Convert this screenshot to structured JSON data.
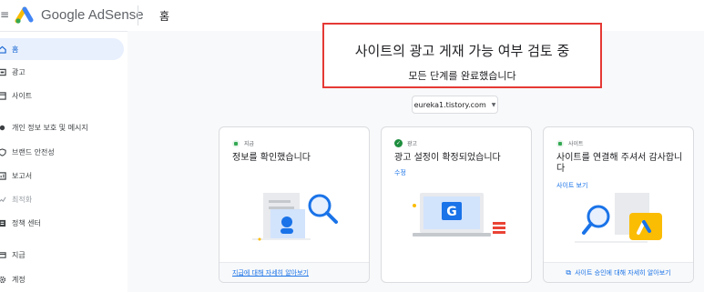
{
  "header": {
    "brand": "Google AdSense",
    "breadcrumb": "홈"
  },
  "sidebar": {
    "items": [
      {
        "label": "홈",
        "icon": "home-icon"
      },
      {
        "label": "광고",
        "icon": "ads-icon"
      },
      {
        "label": "사이트",
        "icon": "sites-icon"
      },
      {
        "label": "개인 정보 보호 및 메시지",
        "icon": "privacy-icon"
      },
      {
        "label": "브랜드 안전성",
        "icon": "shield-icon"
      },
      {
        "label": "보고서",
        "icon": "reports-icon"
      },
      {
        "label": "최적화",
        "icon": "optimization-icon"
      },
      {
        "label": "정책 센터",
        "icon": "policy-icon"
      },
      {
        "label": "지급",
        "icon": "payments-icon"
      },
      {
        "label": "계정",
        "icon": "account-gear-icon"
      }
    ]
  },
  "review": {
    "title": "사이트의 광고 게재 가능 여부 검토 중",
    "subtitle": "모든 단계를 완료했습니다"
  },
  "site_selector": {
    "value": "eureka1.tistory.com"
  },
  "cards": [
    {
      "tag": "지급",
      "title": "정보를 확인했습니다",
      "footer": "지급에 대해 자세히 알아보기"
    },
    {
      "tag": "광고",
      "title": "광고 설정이 확정되었습니다",
      "link": "수정"
    },
    {
      "tag": "사이트",
      "title": "사이트를 연결해 주셔서 감사합니다",
      "link": "사이트 보기",
      "footer": "사이트 승인에 대해 자세히 알아보기"
    }
  ],
  "colors": {
    "accent": "#1a73e8",
    "highlight_border": "#e53935",
    "success": "#1e8e3e"
  }
}
